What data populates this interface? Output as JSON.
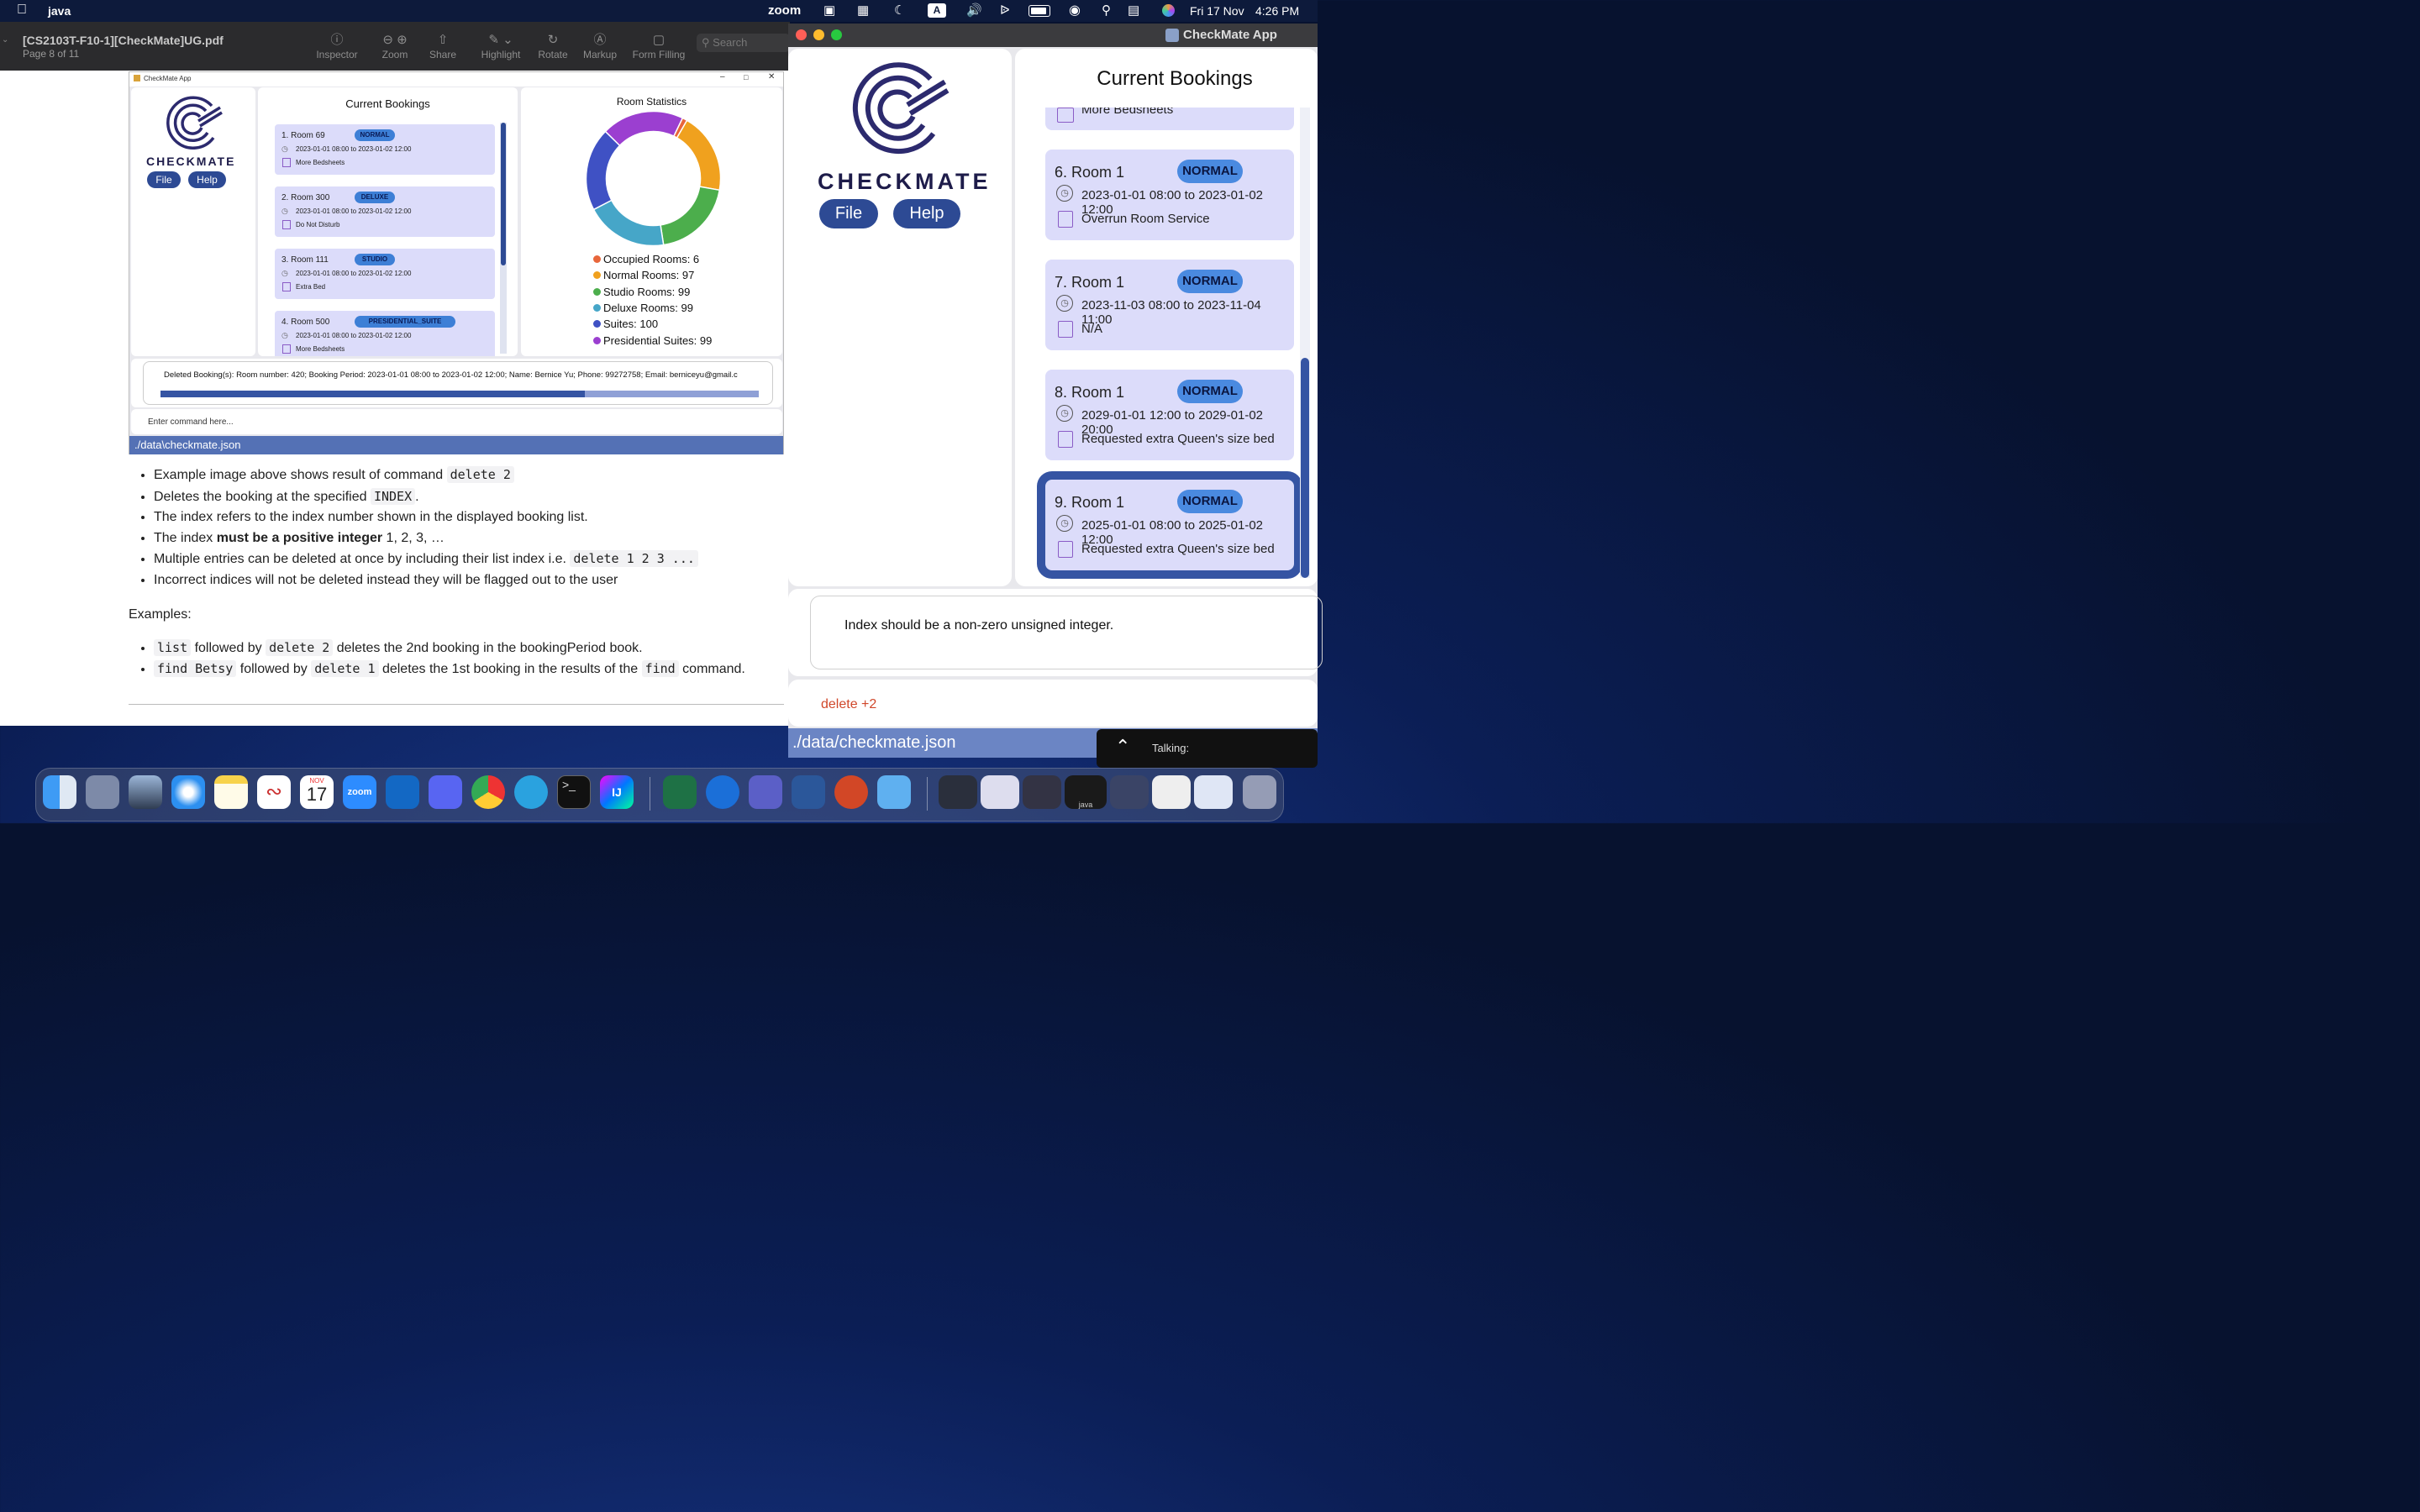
{
  "menubar": {
    "app_name": "java",
    "items": [
      "zoom",
      "Fri 17 Nov",
      "4:26 PM"
    ]
  },
  "pdf": {
    "title": "[CS2103T-F10-1][CheckMate]UG.pdf",
    "page": "Page 8 of 11",
    "toolbar": [
      "Inspector",
      "Zoom",
      "Share",
      "Highlight",
      "Rotate",
      "Markup",
      "Form Filling"
    ],
    "search_placeholder": "Search",
    "embedded": {
      "window_title": "CheckMate App",
      "logo_text": "CHECKMATE",
      "file_btn": "File",
      "help_btn": "Help",
      "bookings_title": "Current Bookings",
      "bookings": [
        {
          "idx": "1.",
          "room": "Room 69",
          "type": "NORMAL",
          "period": "2023-01-01 08:00 to 2023-01-02 12:00",
          "remark": "More Bedsheets"
        },
        {
          "idx": "2.",
          "room": "Room 300",
          "type": "DELUXE",
          "period": "2023-01-01 08:00 to 2023-01-02 12:00",
          "remark": "Do Not Disturb"
        },
        {
          "idx": "3.",
          "room": "Room 111",
          "type": "STUDIO",
          "period": "2023-01-01 08:00 to 2023-01-02 12:00",
          "remark": "Extra Bed"
        },
        {
          "idx": "4.",
          "room": "Room 500",
          "type": "PRESIDENTIAL_SUITE",
          "period": "2023-01-01 08:00 to 2023-01-02 12:00",
          "remark": "More Bedsheets"
        }
      ],
      "stats_title": "Room Statistics",
      "stats": [
        {
          "label": "Occupied Rooms: 6",
          "color": "#e8663b",
          "value": 6
        },
        {
          "label": "Normal Rooms: 97",
          "color": "#f0a11e",
          "value": 97
        },
        {
          "label": "Studio Rooms: 99",
          "color": "#4cae4c",
          "value": 99
        },
        {
          "label": "Deluxe Rooms: 99",
          "color": "#46a6c8",
          "value": 99
        },
        {
          "label": "Suites: 100",
          "color": "#3f51c4",
          "value": 100
        },
        {
          "label": "Presidential Suites: 99",
          "color": "#9b3fd0",
          "value": 99
        }
      ],
      "result": "Deleted Booking(s): Room number: 420; Booking Period: 2023-01-01 08:00 to 2023-01-02 12:00; Name: Bernice Yu; Phone: 99272758; Email: berniceyu@gmail.c",
      "command_placeholder": "Enter command here...",
      "status": "./data\\checkmate.json"
    },
    "doc": {
      "bullets1": [
        [
          "Example image above shows result of command ",
          "delete 2",
          ""
        ],
        [
          "Deletes the booking at the specified ",
          "INDEX",
          "."
        ],
        [
          "The index refers to the index number shown in the displayed booking list.",
          "",
          ""
        ],
        [
          "Multiple entries can be deleted at once by including their list index i.e. ",
          "delete 1 2 3 ...",
          ""
        ],
        [
          "Incorrect indices will not be deleted instead they will be flagged out to the user",
          "",
          ""
        ]
      ],
      "positive_pre": "The index ",
      "positive_bold": "must be a positive integer",
      "positive_post": " 1, 2, 3, …",
      "examples_label": "Examples:",
      "ex1": [
        "list",
        " followed by ",
        "delete 2",
        " deletes the 2nd booking in the bookingPeriod book."
      ],
      "ex2": [
        "find Betsy",
        " followed by ",
        "delete 1",
        " deletes the 1st booking in the results of the ",
        "find",
        " command."
      ]
    }
  },
  "checkmate": {
    "window_title": "CheckMate App",
    "logo_text": "CHECKMATE",
    "file_btn": "File",
    "help_btn": "Help",
    "bookings_title": "Current Bookings",
    "partial_remark": "More Bedsheets",
    "bookings": [
      {
        "idx": "6.",
        "room": "Room 1",
        "type": "NORMAL",
        "period": "2023-01-01 08:00 to 2023-01-02 12:00",
        "remark": "Overrun Room Service"
      },
      {
        "idx": "7.",
        "room": "Room 1",
        "type": "NORMAL",
        "period": "2023-11-03 08:00 to 2023-11-04 11:00",
        "remark": "N/A"
      },
      {
        "idx": "8.",
        "room": "Room 1",
        "type": "NORMAL",
        "period": "2029-01-01 12:00 to 2029-01-02 20:00",
        "remark": "Requested extra Queen's size bed"
      },
      {
        "idx": "9.",
        "room": "Room 1",
        "type": "NORMAL",
        "period": "2025-01-01 08:00 to 2025-01-02 12:00",
        "remark": "Requested extra Queen's size bed"
      }
    ],
    "result": "Index should be a non-zero unsigned integer.",
    "command_value": "delete +2",
    "status": "./data/checkmate.json",
    "zoom_talking": "Talking:"
  },
  "dock": {
    "calendar_month": "NOV",
    "calendar_day": "17",
    "zoom_label": "zoom",
    "intellij_label": "IJ",
    "java_label": "java"
  }
}
